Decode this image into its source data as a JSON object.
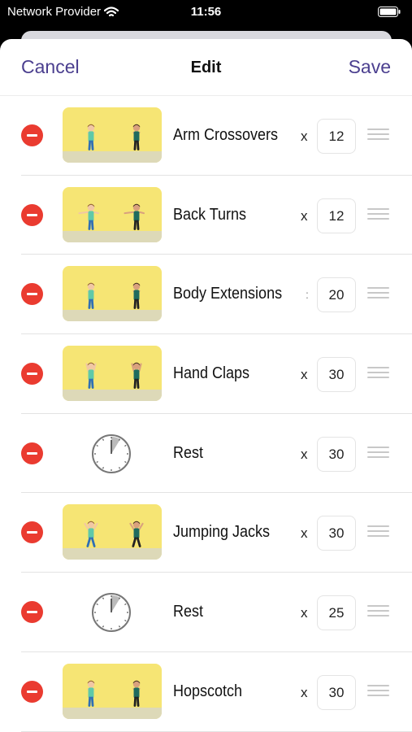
{
  "status_bar": {
    "carrier": "Network Provider",
    "time": "11:56",
    "wifi_icon": "wifi-icon",
    "battery_icon": "battery-icon"
  },
  "nav": {
    "cancel_label": "Cancel",
    "title": "Edit",
    "save_label": "Save"
  },
  "exercises": [
    {
      "name": "Arm Crossovers",
      "times": "x",
      "count": "12",
      "thumb": "illustration"
    },
    {
      "name": "Back Turns",
      "times": "x",
      "count": "12",
      "thumb": "illustration"
    },
    {
      "name": "Body Extensions",
      "times": ":",
      "count": "20",
      "thumb": "illustration"
    },
    {
      "name": "Hand Claps",
      "times": "x",
      "count": "30",
      "thumb": "illustration"
    },
    {
      "name": "Rest",
      "times": "x",
      "count": "30",
      "thumb": "clock-icon"
    },
    {
      "name": "Jumping Jacks",
      "times": "x",
      "count": "30",
      "thumb": "illustration"
    },
    {
      "name": "Rest",
      "times": "x",
      "count": "25",
      "thumb": "clock-icon"
    },
    {
      "name": "Hopscotch",
      "times": "x",
      "count": "30",
      "thumb": "illustration"
    }
  ],
  "colors": {
    "accent": "#4b3f8f",
    "delete": "#ea3b30",
    "thumb_bg": "#f6e574"
  }
}
